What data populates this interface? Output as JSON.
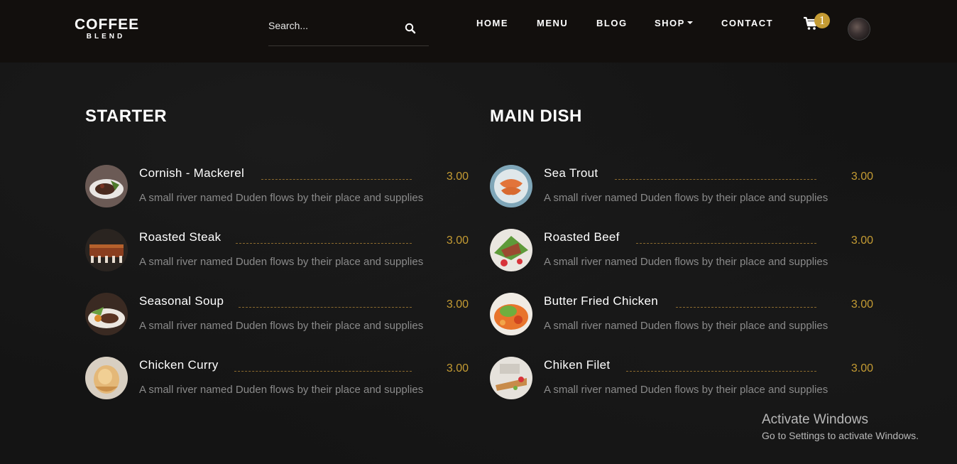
{
  "brand": {
    "main": "COFFEE",
    "sub": "BLEND"
  },
  "search": {
    "placeholder": "Search...",
    "icon": "search-icon"
  },
  "nav": {
    "items": [
      {
        "label": "HOME"
      },
      {
        "label": "MENU"
      },
      {
        "label": "BLOG"
      },
      {
        "label": "SHOP",
        "dropdown": true
      },
      {
        "label": "CONTACT"
      }
    ]
  },
  "cart": {
    "icon": "cart-icon",
    "count": "1"
  },
  "accent_color": "#c49b33",
  "menu": {
    "starter": {
      "title": "STARTER",
      "items": [
        {
          "name": "Cornish - Mackerel",
          "price": "3.00",
          "description": "A small river named Duden flows by their place and supplies"
        },
        {
          "name": "Roasted Steak",
          "price": "3.00",
          "description": "A small river named Duden flows by their place and supplies"
        },
        {
          "name": "Seasonal Soup",
          "price": "3.00",
          "description": "A small river named Duden flows by their place and supplies"
        },
        {
          "name": "Chicken Curry",
          "price": "3.00",
          "description": "A small river named Duden flows by their place and supplies"
        }
      ]
    },
    "main_dish": {
      "title": "MAIN DISH",
      "items": [
        {
          "name": "Sea Trout",
          "price": "3.00",
          "description": "A small river named Duden flows by their place and supplies"
        },
        {
          "name": "Roasted Beef",
          "price": "3.00",
          "description": "A small river named Duden flows by their place and supplies"
        },
        {
          "name": "Butter Fried Chicken",
          "price": "3.00",
          "description": "A small river named Duden flows by their place and supplies"
        },
        {
          "name": "Chiken Filet",
          "price": "3.00",
          "description": "A small river named Duden flows by their place and supplies"
        }
      ]
    }
  },
  "watermark": {
    "title": "Activate Windows",
    "subtitle": "Go to Settings to activate Windows."
  }
}
